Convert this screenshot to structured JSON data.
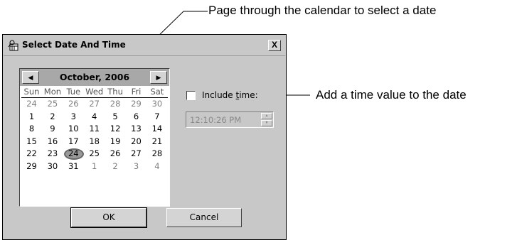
{
  "callouts": {
    "top": "Page through the calendar to select a date",
    "right": "Add a time value to the date"
  },
  "dialog": {
    "title": "Select Date And Time",
    "close_label": "X"
  },
  "calendar": {
    "month_label": "October, 2006",
    "prev_label": "◀",
    "next_label": "▶",
    "days_of_week": [
      "Sun",
      "Mon",
      "Tue",
      "Wed",
      "Thu",
      "Fri",
      "Sat"
    ],
    "weeks": [
      [
        "24",
        "25",
        "26",
        "27",
        "28",
        "29",
        "30"
      ],
      [
        "1",
        "2",
        "3",
        "4",
        "5",
        "6",
        "7"
      ],
      [
        "8",
        "9",
        "10",
        "11",
        "12",
        "13",
        "14"
      ],
      [
        "15",
        "16",
        "17",
        "18",
        "19",
        "20",
        "21"
      ],
      [
        "22",
        "23",
        "24",
        "25",
        "26",
        "27",
        "28"
      ],
      [
        "29",
        "30",
        "31",
        "1",
        "2",
        "3",
        "4"
      ]
    ],
    "selected_day": "24"
  },
  "time": {
    "include_label_pre": "Include ",
    "include_label_accel": "t",
    "include_label_post": "ime:",
    "include_checked": false,
    "value": "12:10:26 PM"
  },
  "buttons": {
    "ok": "OK",
    "cancel": "Cancel"
  }
}
